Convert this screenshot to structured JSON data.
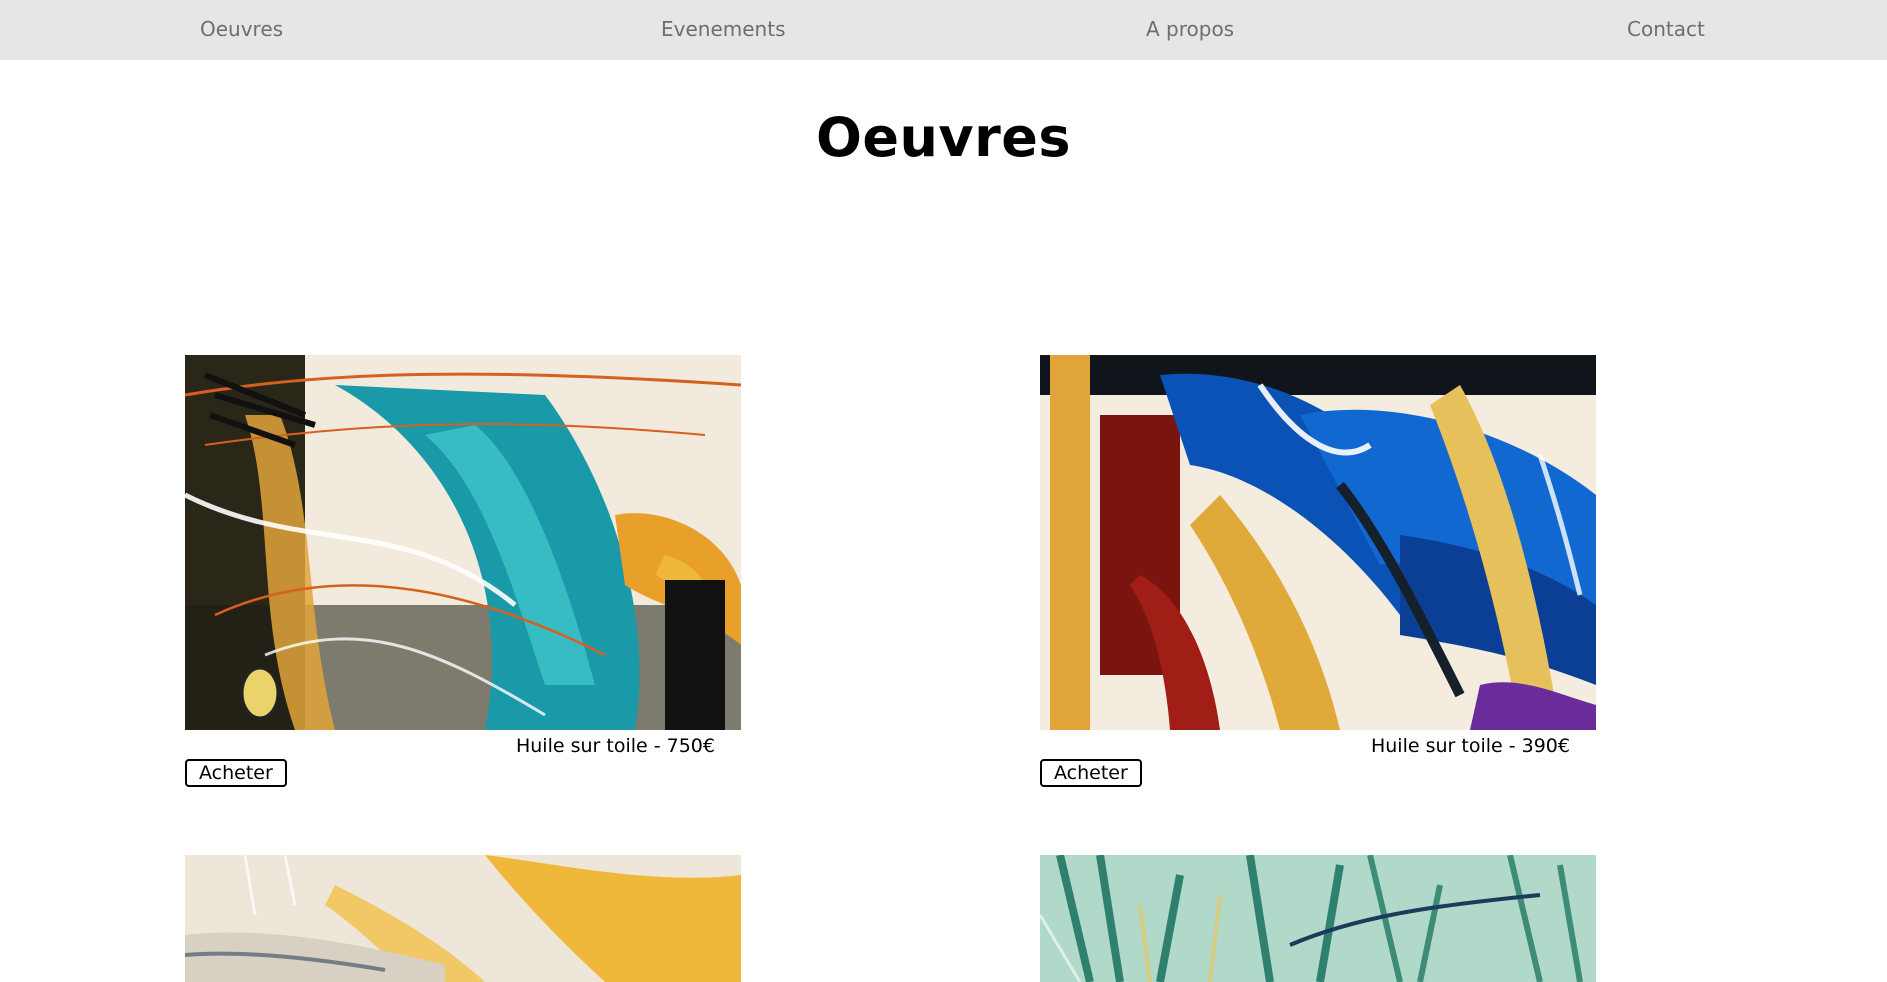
{
  "nav": {
    "items": [
      {
        "label": "Oeuvres"
      },
      {
        "label": "Evenements"
      },
      {
        "label": "A propos"
      },
      {
        "label": "Contact"
      }
    ]
  },
  "page": {
    "title": "Oeuvres"
  },
  "artworks": [
    {
      "caption": "Huile sur toile - 750€",
      "buy_label": "Acheter",
      "colors": [
        "#f2eadc",
        "#1a9aa8",
        "#e9a02a",
        "#1b1b14",
        "#d8601e",
        "#ffffff"
      ]
    },
    {
      "caption": "Huile sur toile - 390€",
      "buy_label": "Acheter",
      "colors": [
        "#f4ecdf",
        "#0a52b6",
        "#7a140e",
        "#e0aa3a",
        "#15202b",
        "#6a2c9a"
      ]
    },
    {
      "colors": [
        "#efe6da",
        "#f0b329",
        "#d9d0c4",
        "#4a5a6a"
      ]
    },
    {
      "colors": [
        "#9ad0c2",
        "#0f6b55",
        "#d3e6d8",
        "#1c3a5a"
      ]
    }
  ],
  "theme": {
    "nav_background": "#e6e6e6",
    "nav_text": "#6e6e6e",
    "page_background": "#ffffff"
  }
}
